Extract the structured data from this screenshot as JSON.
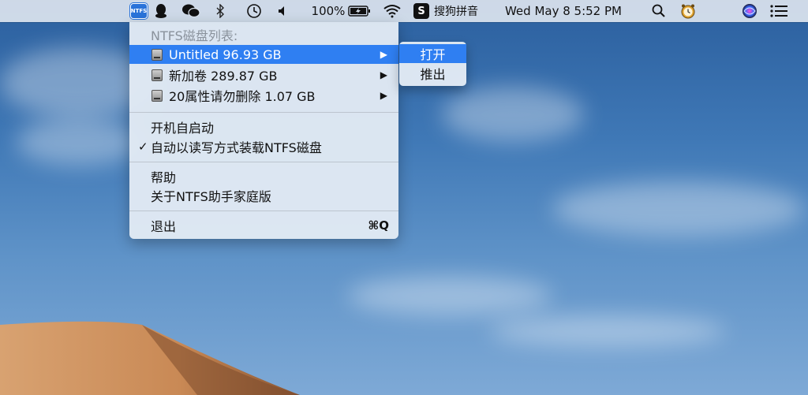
{
  "menubar": {
    "apps": {
      "ntfs_label": "NTFS",
      "sogou_glyph": "S",
      "sogou_label": "搜狗拼音"
    },
    "battery": "100%",
    "clock": "Wed May 8  5:52 PM",
    "icons": [
      "ntfs-icon",
      "qq-icon",
      "wechat-icon",
      "bluetooth-icon",
      "time-machine-icon",
      "volume-icon",
      "battery-icon",
      "wifi-icon",
      "sogou-icon",
      "search-icon",
      "clock-app-icon",
      "siri-icon",
      "notification-list-icon"
    ]
  },
  "menu": {
    "header": "NTFS磁盘列表:",
    "disks": [
      {
        "label": "Untitled  96.93 GB",
        "selected": true
      },
      {
        "label": "新加卷  289.87 GB",
        "selected": false
      },
      {
        "label": "20属性请勿删除  1.07 GB",
        "selected": false
      }
    ],
    "launch_at_login": "开机自启动",
    "auto_mount": "自动以读写方式装载NTFS磁盘",
    "auto_mount_checked": "✓",
    "help": "帮助",
    "about": "关于NTFS助手家庭版",
    "quit": "退出",
    "quit_shortcut": "⌘Q",
    "submenu_arrow": "▶"
  },
  "submenu": {
    "open": "打开",
    "eject": "推出"
  },
  "colors": {
    "highlight": "#2f7ff2",
    "menubar_bg": "#dce4ee"
  }
}
